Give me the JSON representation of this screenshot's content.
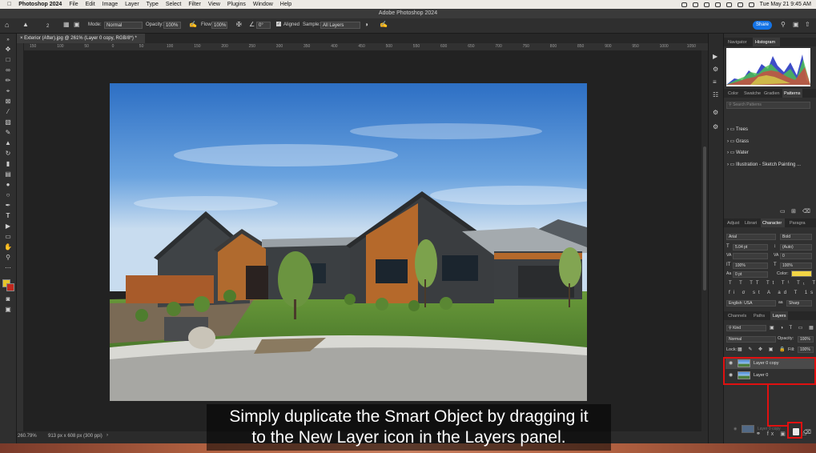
{
  "menubar": {
    "apple": "",
    "items": [
      "Photoshop 2024",
      "File",
      "Edit",
      "Image",
      "Layer",
      "Type",
      "Select",
      "Filter",
      "View",
      "Plugins",
      "Window",
      "Help"
    ],
    "clock": "Tue May 21  9:45 AM"
  },
  "titlebar": {
    "title": "Adobe Photoshop 2024"
  },
  "options": {
    "brush_size": "2",
    "mode_label": "Mode:",
    "mode_value": "Normal",
    "opacity_label": "Opacity:",
    "opacity_value": "100%",
    "flow_label": "Flow:",
    "flow_value": "100%",
    "angle_value": "0°",
    "aligned_label": "Aligned",
    "sample_label": "Sample:",
    "sample_value": "All Layers",
    "share_label": "Share"
  },
  "document": {
    "tab_title": "Exterior (After).jpg @ 261% (Layer 0 copy, RGB/8*) *",
    "ruler_marks": [
      "150",
      "100",
      "50",
      "0",
      "50",
      "100",
      "150",
      "200",
      "250",
      "300",
      "350",
      "400",
      "450",
      "500",
      "550",
      "600",
      "650",
      "700",
      "750",
      "800",
      "850",
      "900",
      "950",
      "1000",
      "1050"
    ],
    "zoom": "260.79%",
    "doc_info": "913 px x 608 px (300 ppi)"
  },
  "panels": {
    "top_tabs": [
      "Navigator",
      "Histogram"
    ],
    "top_active": "Histogram",
    "pattern_tabs": [
      "Color",
      "Swatche",
      "Gradien",
      "Patterns"
    ],
    "pattern_active": "Patterns",
    "search_placeholder": "Search Patterns",
    "pattern_groups": [
      "Trees",
      "Grass",
      "Water",
      "Illustration - Sketch Painting ..."
    ],
    "char_tabs": [
      "Adjust",
      "Librari",
      "Character",
      "Paragra"
    ],
    "char_active": "Character",
    "font_family": "Arial",
    "font_style": "Bold",
    "font_size": "5.04 pt",
    "leading": "(Auto)",
    "tracking": "0",
    "scale_v": "100%",
    "scale_h": "100%",
    "baseline": "0 pt",
    "color_label": "Color:",
    "text_color": "#f2d545",
    "language": "English: USA",
    "antialias": "Sharp",
    "layers_tabs": [
      "Channels",
      "Paths",
      "Layers"
    ],
    "layers_active": "Layers",
    "kind": "Kind",
    "blend_mode": "Normal",
    "opacity_label": "Opacity:",
    "opacity_value": "100%",
    "lock_label": "Lock:",
    "fill_label": "Fill:",
    "fill_value": "100%",
    "layers": [
      "Layer 0 copy",
      "Layer 0"
    ],
    "drag_layer_ghost": "Layer 0 copy"
  },
  "caption": {
    "line1": "Simply duplicate the Smart Object by dragging it",
    "line2": "to the New Layer icon in the Layers panel."
  }
}
